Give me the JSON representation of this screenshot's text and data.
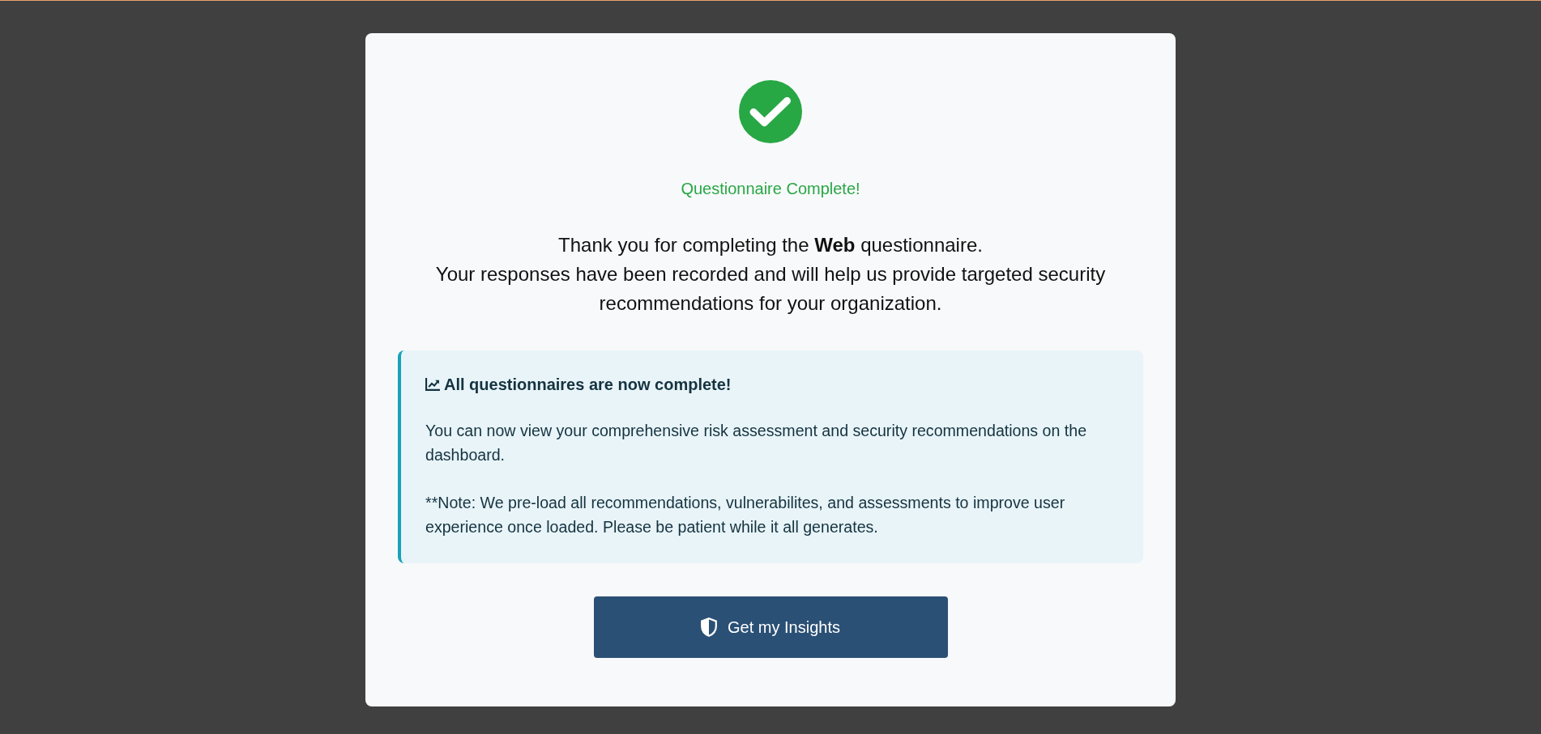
{
  "card": {
    "title": "Questionnaire Complete!",
    "message_lines": [
      "Thank you for completing the **Web** questionnaire.",
      "Your responses have been recorded and will help us provide targeted security recommendations for your organization."
    ]
  },
  "info_panel": {
    "title": "All questionnaires are now complete!",
    "paragraphs": [
      "You can now view your comprehensive risk assessment and security recommendations on the dashboard.",
      "**Note: We pre-load all recommendations, vulnerabilites, and assessments to improve user experience once loaded. Please be patient while it all generates."
    ]
  },
  "button": {
    "label": "Get my Insights"
  }
}
